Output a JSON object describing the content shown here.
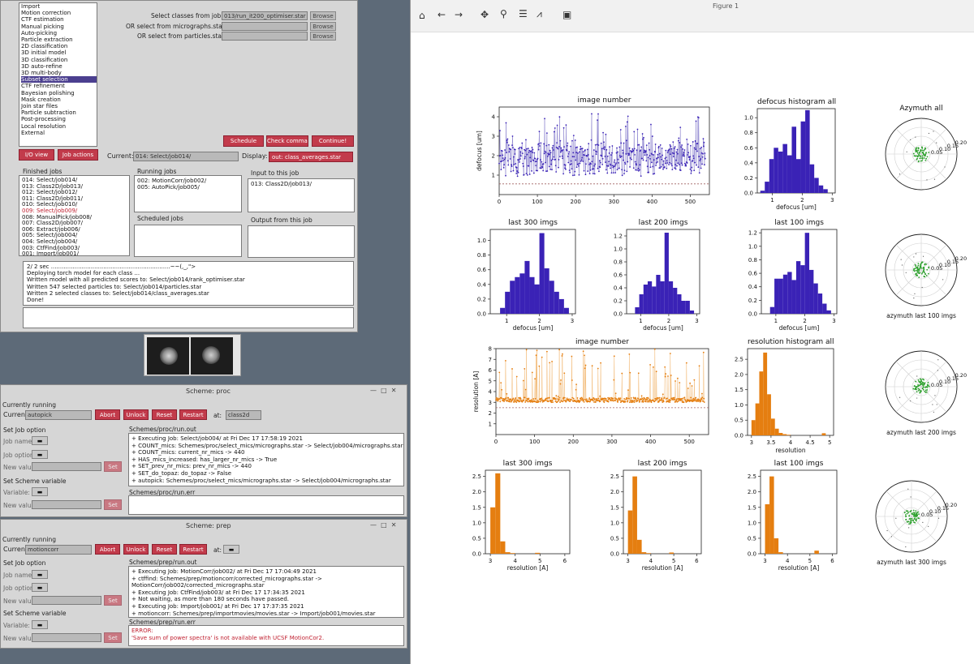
{
  "relion": {
    "job_types": [
      "Import",
      "Motion correction",
      "CTF estimation",
      "Manual picking",
      "Auto-picking",
      "Particle extraction",
      "2D classification",
      "3D initial model",
      "3D classification",
      "3D auto-refine",
      "3D multi-body",
      "Subset selection",
      "CTF refinement",
      "Bayesian polishing",
      "Mask creation",
      "Join star files",
      "Particle subtraction",
      "Post-processing",
      "Local resolution",
      "External"
    ],
    "selected_index": 11,
    "form": {
      "l1": "Select classes from job:",
      "v1": "013/run_it200_optimiser.star",
      "l2": "OR select from micrographs.star:",
      "l3": "OR select from particles.star:",
      "browse": "Browse"
    },
    "buttons": {
      "schedule": "Schedule",
      "check": "Check command",
      "continue": "Continue!",
      "io": "I/O view",
      "actions": "Job actions"
    },
    "current_label": "Current:",
    "current_value": "014: Select/job014/",
    "display_label": "Display:",
    "display_value": "out: class_averages.star",
    "finished_title": "Finished jobs",
    "finished": [
      "014: Select/job014/",
      "013: Class2D/job013/",
      "012: Select/job012/",
      "011: Class2D/job011/",
      "010: Select/job010/",
      "009: Select/job009/",
      "008: ManualPick/job008/",
      "007: Class2D/job007/",
      "006: Extract/job006/",
      "005: Select/job004/",
      "004: Select/job004/",
      "003: CtfFind/job003/",
      "001: Import/job001/"
    ],
    "running_title": "Running jobs",
    "running": [
      "002: MotionCorr/job002/",
      "005: AutoPick/job005/"
    ],
    "scheduled_title": "Scheduled jobs",
    "input_title": "Input to this job",
    "input": [
      "013: Class2D/job013/"
    ],
    "output_title": "Output from this job",
    "log": [
      "2/   2 sec ..................................................................~~(,_,\">",
      "Deploying torch model for each class ...",
      "Written model with all predicted scores to: Select/job014/rank_optimiser.star",
      "Written 547 selected particles to: Select/job014/particles.star",
      "Written 2 selected classes to: Select/job014/class_averages.star",
      "Done!"
    ]
  },
  "scheme_proc": {
    "title": "Scheme: proc",
    "currently_running": "Currently running",
    "current_label": "Current:",
    "current_value": "autopick",
    "buttons": {
      "abort": "Abort",
      "unlock": "Unlock",
      "reset": "Reset",
      "restart": "Restart",
      "at": "at:",
      "at_value": "class2d",
      "set": "Set"
    },
    "set_job_option": "Set Job option",
    "job_name": "Job name:",
    "job_option": "Job option:",
    "new_value": "New value:",
    "set_scheme_variable": "Set Scheme variable",
    "variable": "Variable:",
    "out_title": "Schemes/proc/run.out",
    "out": [
      "+ Executing Job: Select/job004/ at Fri Dec 17 17:58:19 2021",
      "+ COUNT_mics: Schemes/proc/select_mics/micrographs.star -> Select/job004/micrographs.star",
      "+ COUNT_mics: current_nr_mics -> 440",
      "+ HAS_mics_increased: has_larger_nr_mics -> True",
      "+ SET_prev_nr_mics: prev_nr_mics -> 440",
      "+ SET_do_topaz: do_topaz -> False",
      "+ autopick: Schemes/proc/select_mics/micrographs.star -> Select/job004/micrographs.star"
    ],
    "err_title": "Schemes/proc/run.err"
  },
  "scheme_prep": {
    "title": "Scheme: prep",
    "currently_running": "Currently running",
    "current_label": "Current:",
    "current_value": "motioncorr",
    "buttons": {
      "abort": "Abort",
      "unlock": "Unlock",
      "reset": "Reset",
      "restart": "Restart",
      "at": "at:",
      "set": "Set"
    },
    "set_job_option": "Set Job option",
    "job_name": "Job name:",
    "job_option": "Job option:",
    "new_value": "New value:",
    "set_scheme_variable": "Set Scheme variable",
    "variable": "Variable:",
    "out_title": "Schemes/prep/run.out",
    "out": [
      "+ Executing Job: MotionCorr/job002/ at Fri Dec 17 17:04:49 2021",
      "+ ctffind: Schemes/prep/motioncorr/corrected_micrographs.star ->",
      "MotionCorr/job002/corrected_micrographs.star",
      "+ Executing Job: CtfFind/job003/ at Fri Dec 17 17:34:35 2021",
      "+ Not waiting, as more than 180 seconds have passed.",
      "+ Executing Job: Import/job001/ at Fri Dec 17 17:37:35 2021",
      "+ motioncorr: Schemes/prep/importmovies/movies.star -> Import/job001/movies.star"
    ],
    "err_title": "Schemes/prep/run.err",
    "err": [
      "ERROR:",
      "'Save sum of power spectra' is not available with UCSF MotionCor2."
    ]
  },
  "figure": {
    "title": "Figure 1",
    "titles": {
      "t1": "image number",
      "t2": "defocus histogram all",
      "t3": "Azymuth all",
      "t4": "last 300 imgs",
      "t5": "last 200 imgs",
      "t6": "last 100 imgs",
      "t7": "image number",
      "t8": "resolution histogram all",
      "t9": "last 300 imgs",
      "t10": "last 200 imgs",
      "t11": "last 100 imgs",
      "p1": "azymuth last 100 imgs",
      "p2": "azymuth last 200 imgs",
      "p3": "azymuth last 300 imgs"
    },
    "labels": {
      "defocus": "defocus [um]",
      "resolution": "resolution [A]",
      "ylabel_res": "resolution [A]",
      "ylabel_def": "defocus [um]"
    }
  },
  "colors": {
    "purple": "#3a22b6",
    "orange": "#e57e10",
    "green": "#2ca02c",
    "red_btn": "#c23b4b",
    "highlight": "#4b3f8f"
  },
  "chart_data": [
    {
      "type": "scatter",
      "title": "image number",
      "ylabel": "defocus [um]",
      "xlim": [
        0,
        550
      ],
      "ylim": [
        0,
        4.5
      ],
      "x_ticks": [
        0,
        100,
        200,
        300,
        400,
        500
      ],
      "y_ticks": [
        1,
        2,
        3,
        4
      ],
      "series": [
        {
          "values": "~540 points, mostly 1.0-2.6, spikes up to ~4.2"
        }
      ]
    },
    {
      "type": "bar",
      "title": "defocus histogram all",
      "xlabel": "defocus [um]",
      "x_ticks": [
        1,
        2,
        3
      ],
      "y_ticks": [
        0.0,
        0.2,
        0.4,
        0.6,
        0.8,
        1.0
      ],
      "bins": [
        0.6,
        0.75,
        0.9,
        1.05,
        1.2,
        1.35,
        1.5,
        1.65,
        1.8,
        1.95,
        2.1,
        2.25,
        2.4,
        2.55,
        2.7
      ],
      "values": [
        0.03,
        0.15,
        0.45,
        0.6,
        0.55,
        0.65,
        0.5,
        0.88,
        0.45,
        0.95,
        1.1,
        0.38,
        0.2,
        0.1,
        0.05
      ]
    },
    {
      "type": "bar",
      "title": "last 300 imgs",
      "xlabel": "defocus [um]",
      "x_ticks": [
        1,
        2,
        3
      ],
      "y_ticks": [
        0.0,
        0.2,
        0.4,
        0.6,
        0.8,
        1.0
      ],
      "bins": [
        0.8,
        0.95,
        1.1,
        1.25,
        1.4,
        1.55,
        1.7,
        1.85,
        2.0,
        2.15,
        2.3,
        2.45,
        2.6,
        2.75
      ],
      "values": [
        0.08,
        0.3,
        0.45,
        0.5,
        0.55,
        0.72,
        0.5,
        0.4,
        1.1,
        0.62,
        0.45,
        0.3,
        0.2,
        0.08
      ]
    },
    {
      "type": "bar",
      "title": "last 200 imgs",
      "xlabel": "defocus [um]",
      "x_ticks": [
        1,
        2,
        3
      ],
      "y_ticks": [
        0.0,
        0.2,
        0.4,
        0.6,
        0.8,
        1.0,
        1.2
      ],
      "bins": [
        0.8,
        0.95,
        1.1,
        1.25,
        1.4,
        1.55,
        1.7,
        1.85,
        2.0,
        2.15,
        2.3,
        2.45,
        2.6,
        2.75
      ],
      "values": [
        0.1,
        0.3,
        0.45,
        0.5,
        0.42,
        0.6,
        0.5,
        1.25,
        0.5,
        0.4,
        0.3,
        0.2,
        0.2,
        0.05
      ]
    },
    {
      "type": "bar",
      "title": "last 100 imgs",
      "xlabel": "defocus [um]",
      "x_ticks": [
        1,
        2,
        3
      ],
      "y_ticks": [
        0.0,
        0.2,
        0.4,
        0.6,
        0.8,
        1.0,
        1.2
      ],
      "bins": [
        0.8,
        0.95,
        1.1,
        1.25,
        1.4,
        1.55,
        1.7,
        1.85,
        2.0,
        2.15,
        2.3,
        2.45,
        2.6,
        2.75
      ],
      "values": [
        0.1,
        0.52,
        0.52,
        0.58,
        0.62,
        0.5,
        0.78,
        0.72,
        1.2,
        0.65,
        0.45,
        0.3,
        0.15,
        0.05
      ]
    },
    {
      "type": "scatter",
      "title": "image number",
      "ylabel": "resolution [A]",
      "xlim": [
        0,
        550
      ],
      "ylim": [
        0,
        8
      ],
      "x_ticks": [
        0,
        100,
        200,
        300,
        400,
        500
      ],
      "y_ticks": [
        1,
        2,
        3,
        4,
        5,
        6,
        7,
        8
      ],
      "series": [
        {
          "values": "~540 points, mostly ~3.0-3.5, spikes up to ~8"
        }
      ]
    },
    {
      "type": "bar",
      "title": "resolution histogram all",
      "xlabel": "resolution",
      "x_ticks": [
        3.0,
        3.5,
        4.0,
        4.5,
        5.0
      ],
      "y_ticks": [
        0.0,
        0.5,
        1.0,
        1.5,
        2.0,
        2.5
      ],
      "bins": [
        3.0,
        3.1,
        3.2,
        3.3,
        3.4,
        3.5,
        3.6,
        3.7,
        3.8,
        3.9,
        4.0,
        4.1,
        4.2,
        4.3,
        4.4,
        4.5,
        4.6,
        4.7,
        4.8,
        4.9
      ],
      "values": [
        0.5,
        1.05,
        2.1,
        2.72,
        1.35,
        0.55,
        0.22,
        0.08,
        0.04,
        0.02,
        0.0,
        0.0,
        0.0,
        0.0,
        0.0,
        0.0,
        0.0,
        0.0,
        0.07,
        0.0
      ]
    },
    {
      "type": "bar",
      "title": "last 300 imgs",
      "xlabel": "resolution [A]",
      "x_ticks": [
        3,
        4,
        5,
        6
      ],
      "y_ticks": [
        0.0,
        0.5,
        1.0,
        1.5,
        2.0,
        2.5
      ],
      "bins": [
        3.0,
        3.2,
        3.4,
        3.6,
        3.8,
        4.0,
        4.2,
        4.4,
        4.6,
        4.8,
        5.0
      ],
      "values": [
        1.5,
        2.6,
        0.4,
        0.05,
        0.02,
        0,
        0,
        0,
        0,
        0.03,
        0
      ]
    },
    {
      "type": "bar",
      "title": "last 200 imgs",
      "xlabel": "resolution [A]",
      "x_ticks": [
        3,
        4,
        5,
        6
      ],
      "y_ticks": [
        0.0,
        0.5,
        1.0,
        1.5,
        2.0,
        2.5
      ],
      "bins": [
        3.0,
        3.2,
        3.4,
        3.6,
        3.8,
        4.0,
        4.2,
        4.4,
        4.6,
        4.8,
        5.0
      ],
      "values": [
        1.4,
        2.5,
        0.45,
        0.05,
        0.02,
        0,
        0,
        0,
        0,
        0.04,
        0
      ]
    },
    {
      "type": "bar",
      "title": "last 100 imgs",
      "xlabel": "resolution [A]",
      "x_ticks": [
        3,
        4,
        5,
        6
      ],
      "y_ticks": [
        0.0,
        0.5,
        1.0,
        1.5,
        2.0,
        2.5
      ],
      "bins": [
        3.0,
        3.2,
        3.4,
        3.6,
        3.8,
        4.0,
        4.2,
        4.4,
        4.6,
        4.8,
        5.0,
        5.2
      ],
      "values": [
        1.6,
        2.5,
        0.5,
        0.05,
        0,
        0,
        0,
        0,
        0,
        0,
        0,
        0.1
      ]
    }
  ]
}
